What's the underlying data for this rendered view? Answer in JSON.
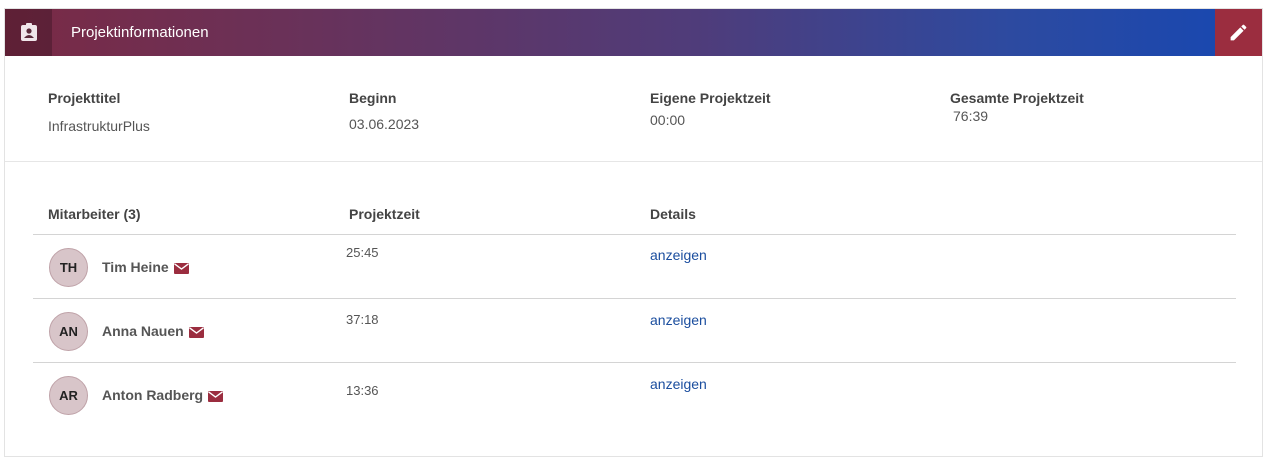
{
  "header": {
    "title": "Projektinformationen",
    "icon": "id-badge-icon",
    "edit_icon": "pencil-icon"
  },
  "info": {
    "title_label": "Projekttitel",
    "title_value": "InfrastrukturPlus",
    "begin_label": "Beginn",
    "begin_value": "03.06.2023",
    "own_time_label": "Eigene Projektzeit",
    "own_time_value": "00:00",
    "total_time_label": "Gesamte Projektzeit",
    "total_time_value": "76:39"
  },
  "table": {
    "col_employee": "Mitarbeiter (3)",
    "col_time": "Projektzeit",
    "col_details": "Details",
    "rows": [
      {
        "initials": "TH",
        "name": "Tim Heine",
        "time": "25:45",
        "details": "anzeigen"
      },
      {
        "initials": "AN",
        "name": "Anna Nauen",
        "time": "37:18",
        "details": "anzeigen"
      },
      {
        "initials": "AR",
        "name": "Anton Radberg",
        "time": "13:36",
        "details": "anzeigen"
      }
    ]
  },
  "colors": {
    "accent": "#9b2d3f",
    "link": "#1a4d9e",
    "avatar_bg": "#d8c5c9"
  }
}
